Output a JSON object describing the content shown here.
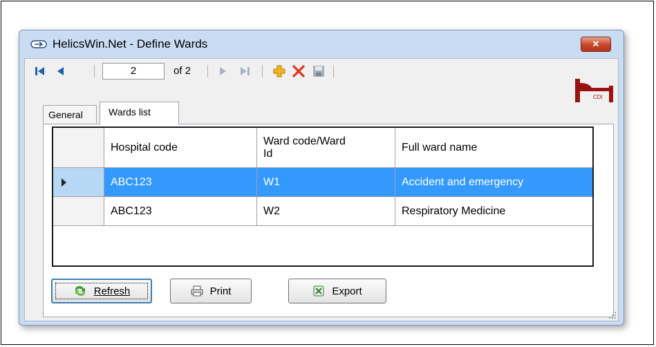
{
  "window": {
    "title": "HelicsWin.Net - Define Wards",
    "close_glyph": "✕"
  },
  "navigator": {
    "current_page": "2",
    "of_label": "of 2",
    "icons": [
      "first-record-icon",
      "previous-record-icon",
      "next-record-icon",
      "last-record-icon",
      "add-record-icon",
      "delete-record-icon",
      "save-record-icon"
    ]
  },
  "logo": {
    "text": "CDI",
    "color": "#9b1212"
  },
  "tabs": [
    {
      "label": "General"
    },
    {
      "label": "Wards list"
    }
  ],
  "grid": {
    "headers": [
      "Hospital code",
      "Ward code/Ward Id",
      "Full ward name"
    ],
    "rows": [
      {
        "hospital_code": "ABC123",
        "ward_code": "W1",
        "ward_name": "Accident and emergency",
        "selected": true
      },
      {
        "hospital_code": "ABC123",
        "ward_code": "W2",
        "ward_name": "Respiratory Medicine",
        "selected": false
      }
    ]
  },
  "buttons": {
    "refresh": "Refresh",
    "print": "Print",
    "export": "Export"
  },
  "colors": {
    "selection": "#3399ff",
    "window_frame": "#c9dcf2",
    "add_icon": "#f2b51c",
    "delete_icon": "#e0311b"
  }
}
